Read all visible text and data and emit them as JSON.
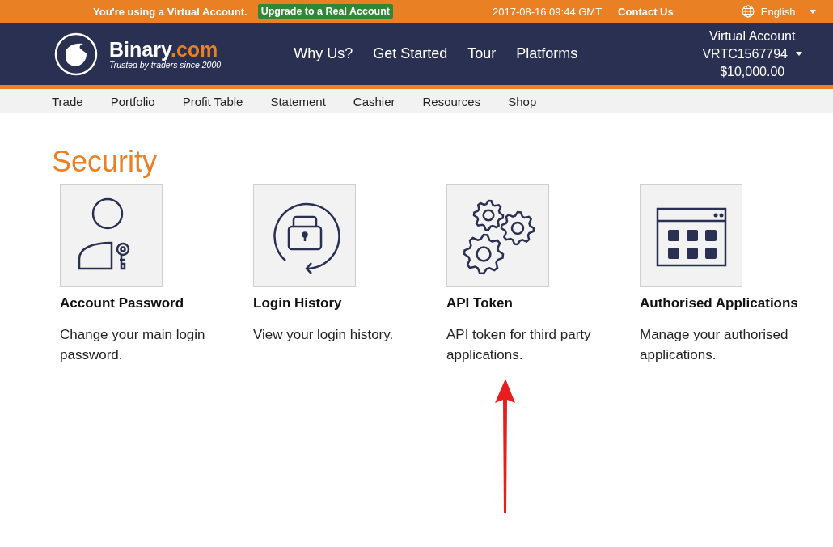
{
  "top_bar": {
    "notice": "You're using a Virtual Account.",
    "upgrade_button": "Upgrade to a Real Account",
    "datetime": "2017-08-16 09:44 GMT",
    "contact": "Contact Us",
    "language": "English"
  },
  "header": {
    "logo_name": "Binary",
    "logo_suffix": ".com",
    "tagline": "Trusted by traders since 2000",
    "nav": [
      "Why Us?",
      "Get Started",
      "Tour",
      "Platforms"
    ],
    "account": {
      "type": "Virtual Account",
      "id": "VRTC1567794",
      "balance": "$10,000.00"
    }
  },
  "sub_nav": [
    "Trade",
    "Portfolio",
    "Profit Table",
    "Statement",
    "Cashier",
    "Resources",
    "Shop"
  ],
  "page_title": "Security",
  "cards": [
    {
      "kind": "password",
      "title": "Account Password",
      "description": "Change your main login password."
    },
    {
      "kind": "history",
      "title": "Login History",
      "description": "View your login history."
    },
    {
      "kind": "token",
      "title": "API Token",
      "description": "API token for third party applications."
    },
    {
      "kind": "apps",
      "title": "Authorised Applications",
      "description": "Manage your authorised applications."
    }
  ]
}
